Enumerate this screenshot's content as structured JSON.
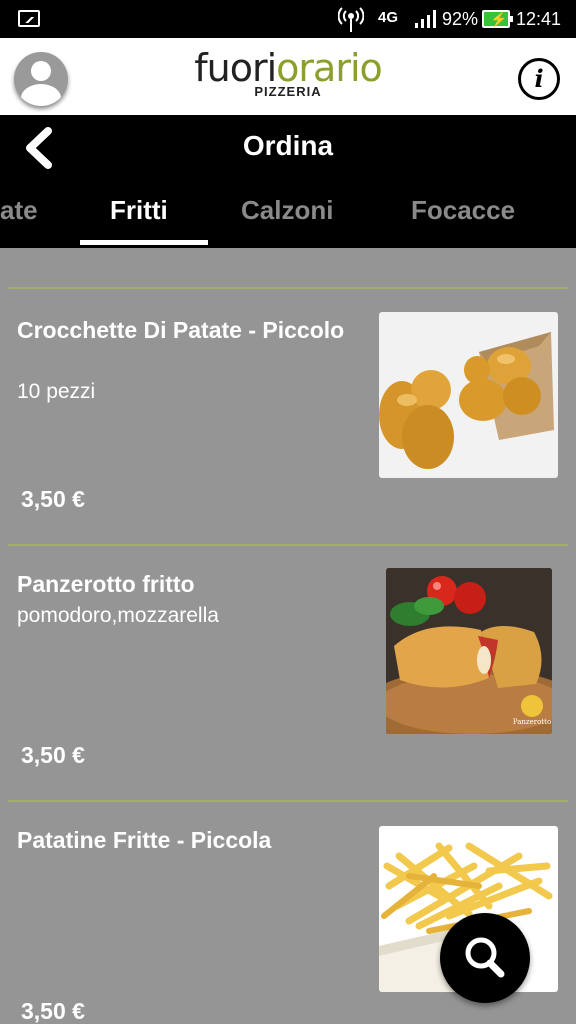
{
  "status_bar": {
    "network": "4G",
    "battery": "92%",
    "time": "12:41",
    "icons": [
      "gallery-icon",
      "hotspot-icon",
      "signal-icon",
      "battery-charging-icon"
    ]
  },
  "header": {
    "brand_part1": "fuori",
    "brand_part2": "orario",
    "brand_sub": "PIZZERIA",
    "info_label": "i",
    "brand_colors": {
      "dark": "#222222",
      "green": "#8ba02a"
    }
  },
  "nav": {
    "title": "Ordina",
    "tabs": [
      {
        "label": "ate"
      },
      {
        "label": "Fritti",
        "active": true
      },
      {
        "label": "Calzoni"
      },
      {
        "label": "Focacce"
      }
    ]
  },
  "products": [
    {
      "title": "Crocchette Di Patate - Piccolo",
      "description": "10 pezzi",
      "price": "3,50 €",
      "image": "croquettes"
    },
    {
      "title": "Panzerotto fritto",
      "description": "pomodoro,mozzarella",
      "price": "3,50 €",
      "image": "panzerotto"
    },
    {
      "title": "Patatine Fritte - Piccola",
      "description": "",
      "price": "3,50 €",
      "image": "french-fries"
    }
  ],
  "colors": {
    "background": "#959595",
    "divider": "#a3ad6a",
    "accent": "#8ba02a"
  }
}
